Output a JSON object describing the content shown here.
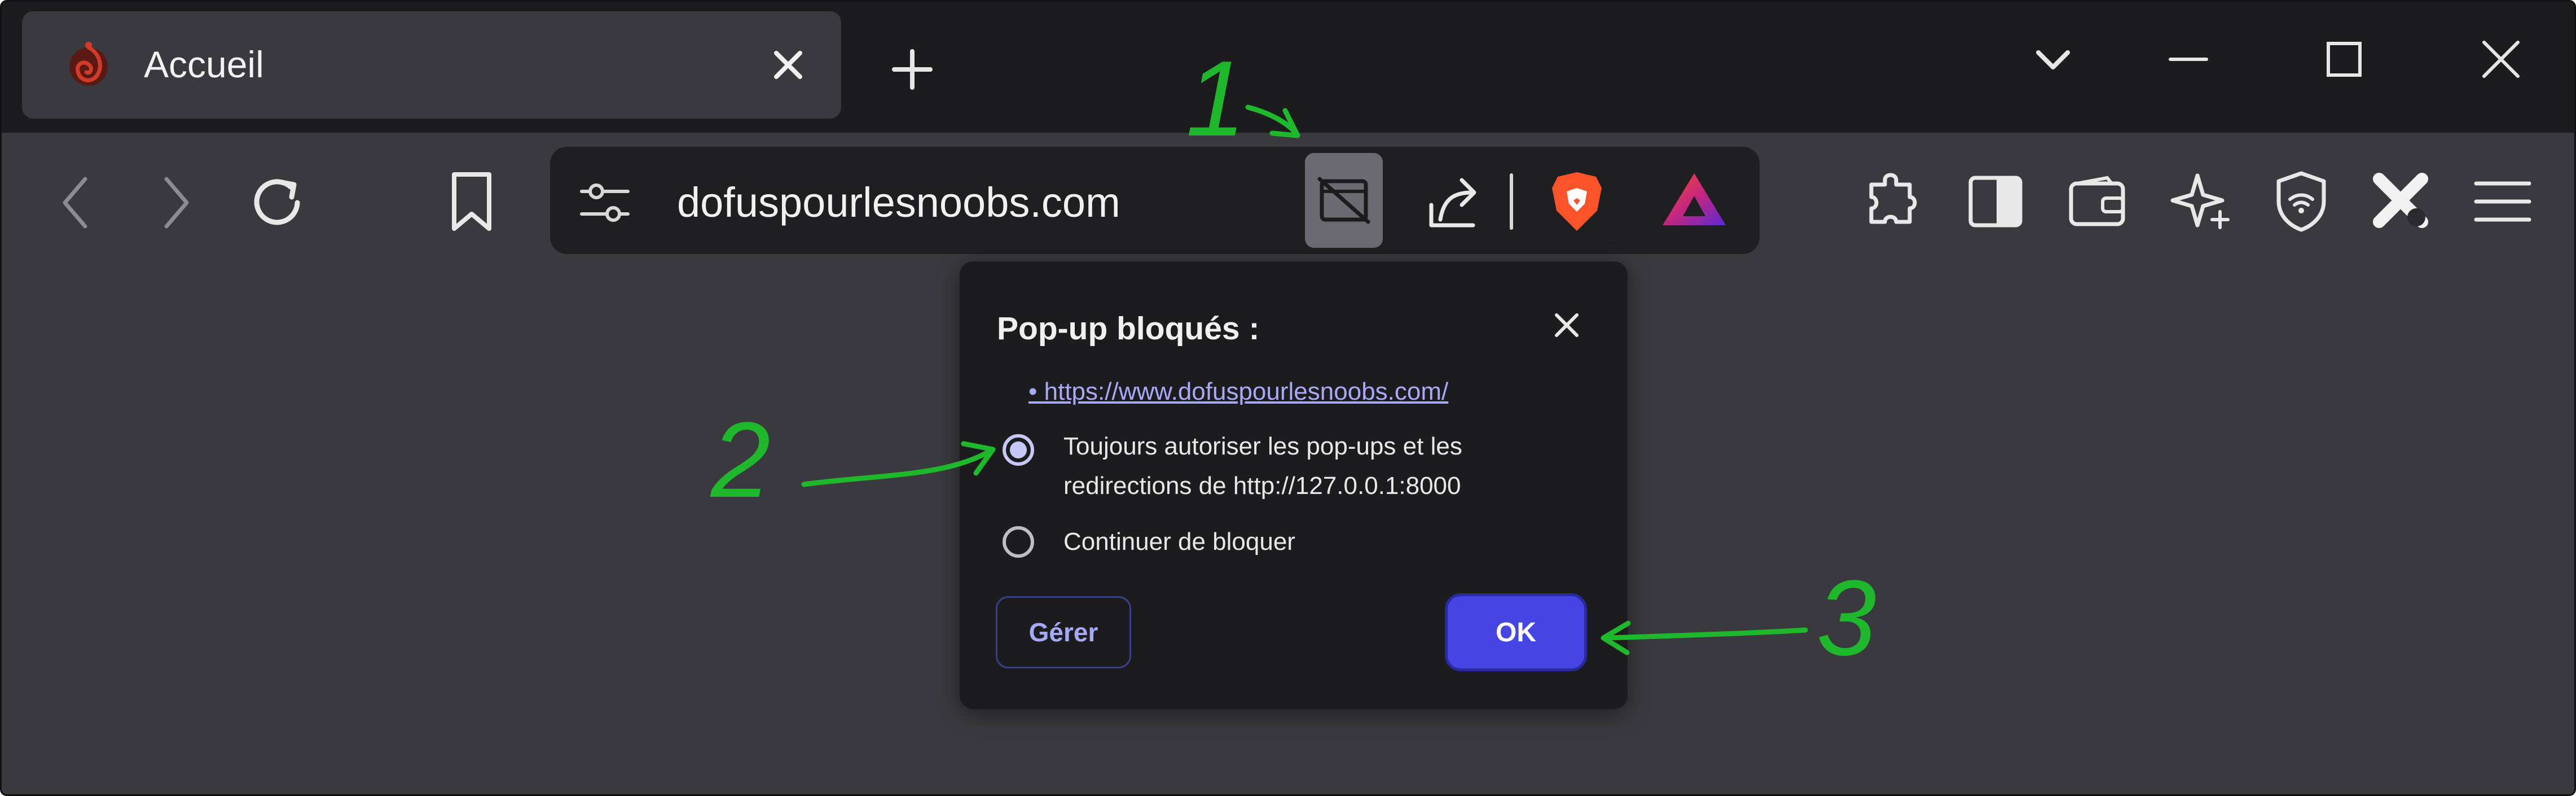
{
  "tab": {
    "title": "Accueil"
  },
  "address_bar": {
    "url": "dofuspourlesnoobs.com"
  },
  "popup": {
    "title": "Pop-up bloqués :",
    "link": "https://www.dofuspourlesnoobs.com/",
    "option_allow_line1": "Toujours autoriser les pop-ups et les",
    "option_allow_line2": "redirections de http://127.0.0.1:8000",
    "option_block": "Continuer de bloquer",
    "selected_option": "allow",
    "manage_label": "Gérer",
    "ok_label": "OK"
  },
  "annotations": {
    "step1": "1",
    "step2": "2",
    "step3": "3",
    "color": "#1fb82c"
  },
  "colors": {
    "accent": "#4545e3",
    "link": "#a9aaf7",
    "brave_orange": "#fb542b"
  },
  "icons": [
    "back-icon",
    "forward-icon",
    "reload-icon",
    "bookmark-icon",
    "site-settings-icon",
    "popup-blocked-icon",
    "share-icon",
    "brave-shields-icon",
    "brave-rewards-icon",
    "extensions-icon",
    "sidebar-icon",
    "wallet-icon",
    "leo-ai-icon",
    "vpn-icon",
    "extension-x-icon",
    "menu-icon"
  ]
}
